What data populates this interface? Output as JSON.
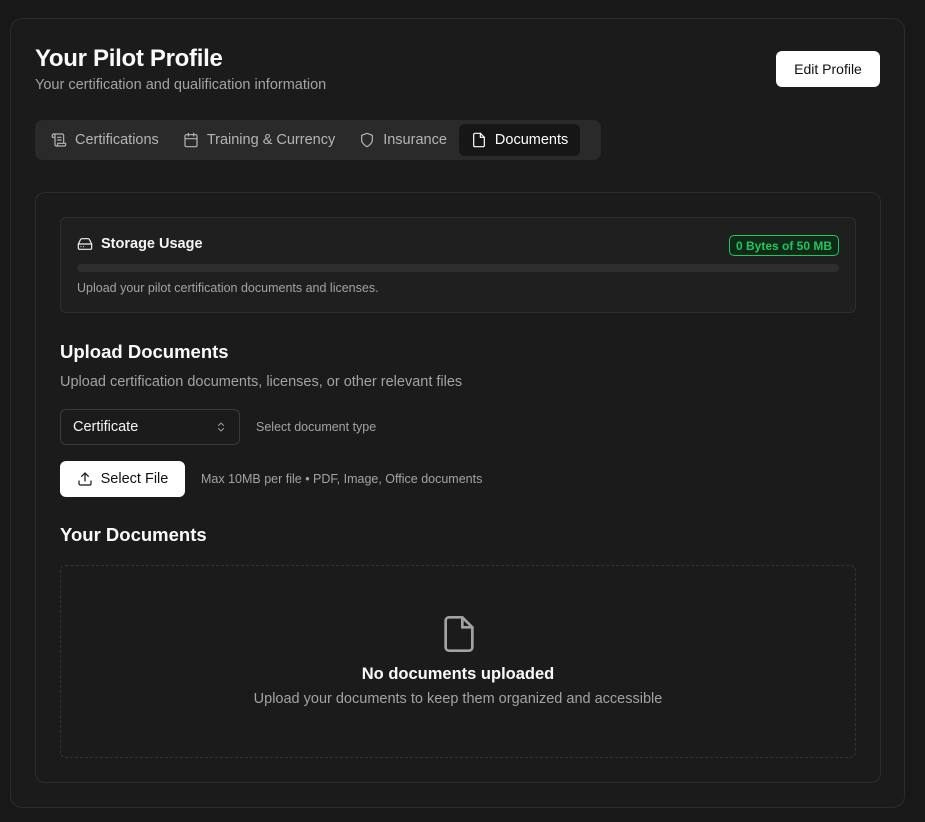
{
  "header": {
    "title": "Your Pilot Profile",
    "subtitle": "Your certification and qualification information",
    "edit_button": "Edit Profile"
  },
  "tabs": [
    {
      "label": "Certifications",
      "icon": "scroll-icon",
      "active": false
    },
    {
      "label": "Training & Currency",
      "icon": "calendar-icon",
      "active": false
    },
    {
      "label": "Insurance",
      "icon": "shield-icon",
      "active": false
    },
    {
      "label": "Documents",
      "icon": "file-icon",
      "active": true
    }
  ],
  "storage": {
    "title": "Storage Usage",
    "icon": "hard-drive-icon",
    "badge": "0 Bytes of 50 MB",
    "used_fraction": 0,
    "note": "Upload your pilot certification documents and licenses.",
    "accent_color": "#22c55e"
  },
  "upload": {
    "title": "Upload Documents",
    "subtitle": "Upload certification documents, licenses, or other relevant files",
    "doc_type_value": "Certificate",
    "doc_type_hint": "Select document type",
    "select_file_label": "Select File",
    "file_hint": "Max 10MB per file • PDF, Image, Office documents"
  },
  "documents": {
    "title": "Your Documents",
    "empty_title": "No documents uploaded",
    "empty_subtitle": "Upload your documents to keep them organized and accessible"
  }
}
